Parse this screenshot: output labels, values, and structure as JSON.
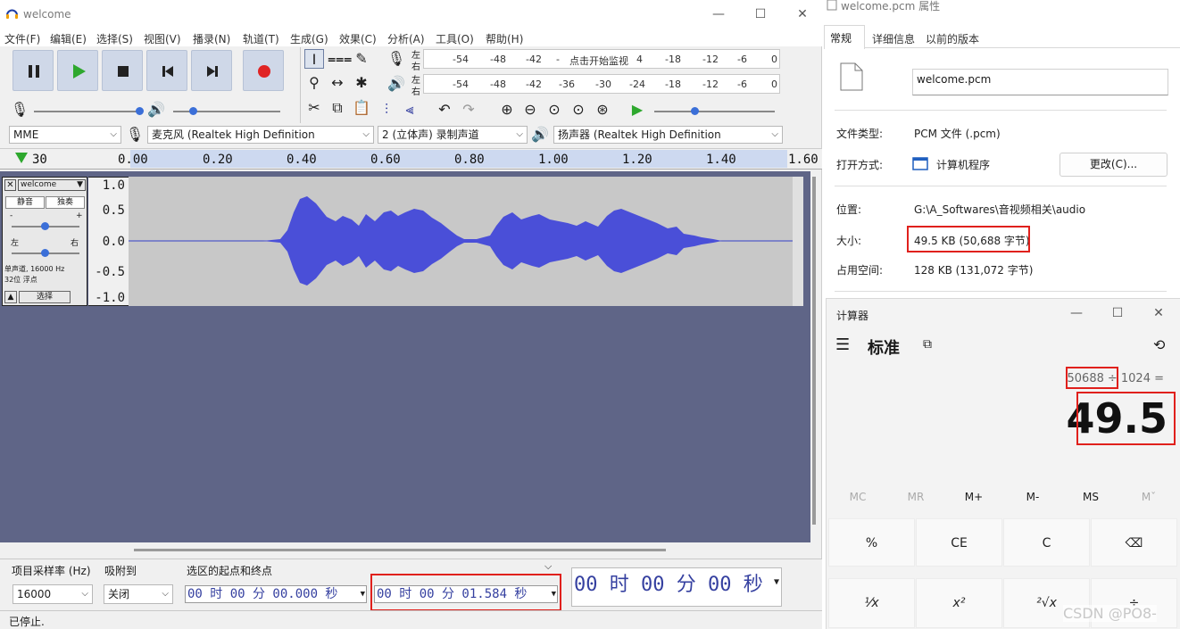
{
  "audacity": {
    "title": "welcome",
    "menu": [
      "文件(F)",
      "编辑(E)",
      "选择(S)",
      "视图(V)",
      "播录(N)",
      "轨道(T)",
      "生成(G)",
      "效果(C)",
      "分析(A)",
      "工具(O)",
      "帮助(H)"
    ],
    "meter_labels": {
      "rec_l": "左",
      "rec_r": "右",
      "play_l": "左",
      "play_r": "右"
    },
    "rec_meter_ticks": [
      "-54",
      "-48",
      "-42",
      "-",
      "点击开始监视",
      "4",
      "-18",
      "-12",
      "-6",
      "0"
    ],
    "play_meter_ticks": [
      "-54",
      "-48",
      "-42",
      "-36",
      "-30",
      "-24",
      "-18",
      "-12",
      "-6",
      "0"
    ],
    "devices": {
      "host": "MME",
      "mic": "麦克风 (Realtek High Definition",
      "channels": "2 (立体声) 录制声道",
      "speaker": "扬声器 (Realtek High Definition"
    },
    "ruler": [
      "30",
      "0.00",
      "0.20",
      "0.40",
      "0.60",
      "0.80",
      "1.00",
      "1.20",
      "1.40",
      "1.60"
    ],
    "track": {
      "name": "welcome",
      "mute": "静音",
      "solo": "独奏",
      "pan_left": "左",
      "pan_right": "右",
      "info_line1": "单声道, 16000 Hz",
      "info_line2": "32位 浮点",
      "select": "选择",
      "gain_minus": "-",
      "gain_plus": "+"
    },
    "vruler": [
      "1.0",
      "0.5",
      "0.0",
      "-0.5",
      "-1.0"
    ],
    "bottom": {
      "rate_label": "项目采样率 (Hz)",
      "snap_label": "吸附到",
      "sel_label": "选区的起点和终点",
      "rate_value": "16000",
      "snap_value": "关闭",
      "start_time": "00 时 00 分 00.000 秒",
      "end_time": "00 时 00 分 01.584 秒",
      "pos_time": "00 时 00 分 00 秒"
    },
    "status": "已停止."
  },
  "properties": {
    "title": "welcome.pcm 属性",
    "tabs": [
      "常规",
      "详细信息",
      "以前的版本"
    ],
    "filename": "welcome.pcm",
    "type_label": "文件类型:",
    "type_value": "PCM 文件 (.pcm)",
    "open_label": "打开方式:",
    "open_value": "计算机程序",
    "change_button": "更改(C)...",
    "location_label": "位置:",
    "location_value": "G:\\A_Softwares\\音视频相关\\audio",
    "size_label": "大小:",
    "size_value": "49.5 KB (50,688 字节)",
    "disk_label": "占用空间:",
    "disk_value": "128 KB (131,072 字节)"
  },
  "calculator": {
    "title": "计算器",
    "mode": "标准",
    "expr_num": "50688",
    "expr_rest": "÷ 1024 =",
    "result": "49.5",
    "memory": [
      "MC",
      "MR",
      "M+",
      "M-",
      "MS",
      "Mˇ"
    ],
    "row1": [
      "%",
      "CE",
      "C",
      "⌫"
    ],
    "row2": [
      "¹⁄x",
      "x²",
      "²√x",
      "÷"
    ]
  },
  "watermark": "CSDN @PO8-"
}
